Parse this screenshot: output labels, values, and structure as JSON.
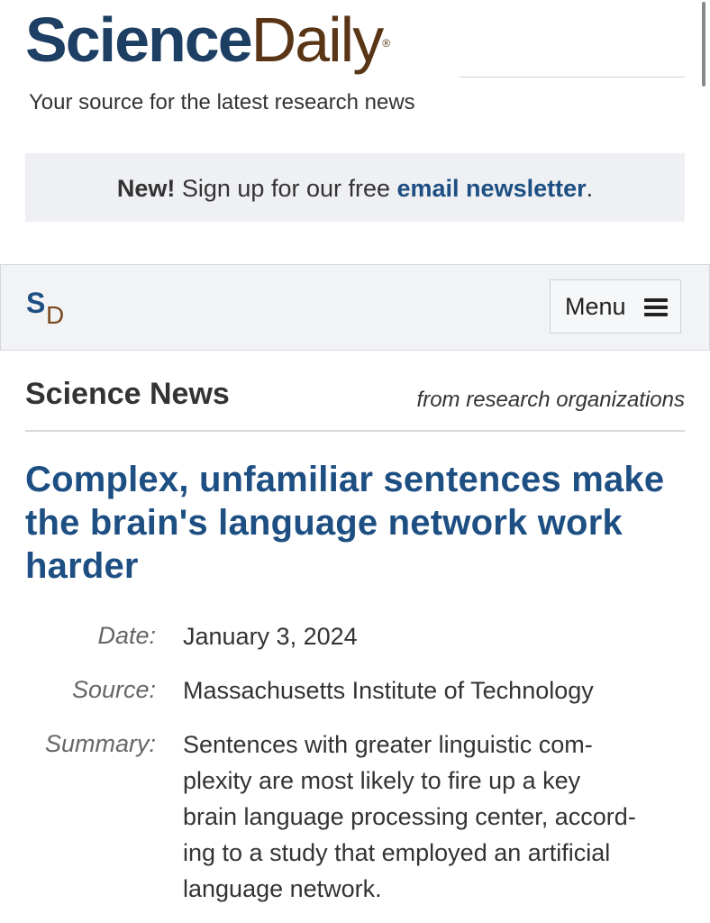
{
  "logo": {
    "science": "Science",
    "daily": "Daily",
    "registered": "®"
  },
  "tagline": "Your source for the latest research news",
  "newsletter": {
    "new": "New!",
    "text": " Sign up for our free ",
    "link": "email newsletter",
    "end": "."
  },
  "nav": {
    "logo_s": "S",
    "logo_d": "D",
    "menu_label": "Menu"
  },
  "section": {
    "title": "Science News",
    "subtitle": "from research organizations"
  },
  "article": {
    "headline": "Complex, unfamiliar sentences make the brain's language network work harder",
    "date_label": "Date:",
    "date": "January 3, 2024",
    "source_label": "Source:",
    "source": "Massachusetts Institute of Technology",
    "summary_label": "Summary:",
    "summary_lines": [
      "Sentences with greater linguistic com-",
      "plexity are most likely to fire up a key",
      "brain language processing center, accord-",
      "ing to a study that employed an artificial",
      "language network."
    ]
  },
  "colors": {
    "brand_blue": "#1d3f64",
    "link_blue": "#1d4f83",
    "brand_brown": "#5a3515"
  },
  "icons": {
    "menu": "hamburger-icon"
  }
}
